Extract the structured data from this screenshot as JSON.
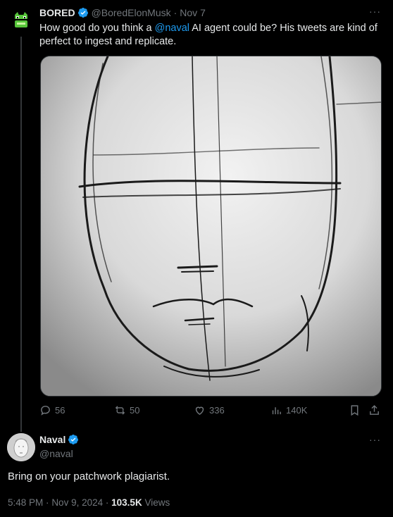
{
  "tweet": {
    "author_name": "BORED",
    "author_handle": "@BoredElonMusk",
    "separator": "·",
    "date": "Nov 7",
    "more": "···",
    "text_before": "How good do you think a ",
    "mention": "@naval",
    "text_after": " AI agent could be? His tweets are kind of perfect to ingest and replicate.",
    "actions": {
      "replies": "56",
      "reposts": "50",
      "likes": "336",
      "views": "140K"
    }
  },
  "reply": {
    "author_name": "Naval",
    "author_handle": "@naval",
    "more": "···",
    "text": "Bring on your patchwork plagiarist.",
    "time": "5:48 PM",
    "separator": "·",
    "date": "Nov 9, 2024",
    "separator2": "·",
    "views_count": "103.5K",
    "views_label": "Views"
  },
  "colors": {
    "accent": "#1d9bf0",
    "text": "#e7e9ea",
    "muted": "#71767b",
    "background": "#000000",
    "avatar_green": "#57c63b"
  },
  "icons": [
    "bored-ape-avatar",
    "verified-badge-icon",
    "reply-icon",
    "repost-icon",
    "like-icon",
    "views-icon",
    "bookmark-icon",
    "share-icon"
  ]
}
